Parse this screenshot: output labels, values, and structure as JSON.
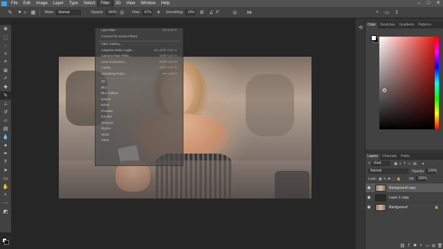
{
  "menu": [
    "File",
    "Edit",
    "Image",
    "Layer",
    "Type",
    "Select",
    "Filter",
    "3D",
    "View",
    "Window",
    "Help"
  ],
  "menu_active_index": 6,
  "window_controls": [
    "–",
    "□",
    "✕"
  ],
  "options": {
    "brush_size": "30",
    "mode_label": "Mode:",
    "mode_value": "Normal",
    "opacity_label": "Opacity:",
    "opacity_value": "100%",
    "flow_label": "Flow:",
    "flow_value": "67%",
    "smoothing_label": "Smoothing:",
    "smoothing_value": "10%",
    "angle_value": "0°"
  },
  "filter_menu": [
    {
      "label": "Last Filter",
      "shortcut": "Alt+Ctrl+F"
    },
    {
      "label": "Convert for Smart Filters",
      "shortcut": ""
    },
    {
      "sep": true
    },
    {
      "label": "Filter Gallery...",
      "shortcut": ""
    },
    {
      "label": "Adaptive Wide Angle...",
      "shortcut": "Alt+Shift+Ctrl+A"
    },
    {
      "label": "Camera Raw Filter...",
      "shortcut": "Shift+Ctrl+A"
    },
    {
      "label": "Lens Correction...",
      "shortcut": "Shift+Ctrl+R"
    },
    {
      "label": "Liquify...",
      "shortcut": "Shift+Ctrl+X"
    },
    {
      "label": "Vanishing Point...",
      "shortcut": "Alt+Ctrl+V"
    },
    {
      "sep": true
    },
    {
      "label": "3D",
      "shortcut": ""
    },
    {
      "label": "Blur",
      "shortcut": ""
    },
    {
      "label": "Blur Gallery",
      "shortcut": ""
    },
    {
      "label": "Distort",
      "shortcut": ""
    },
    {
      "label": "Noise",
      "shortcut": ""
    },
    {
      "label": "Pixelate",
      "shortcut": ""
    },
    {
      "label": "Render",
      "shortcut": ""
    },
    {
      "label": "Sharpen",
      "shortcut": ""
    },
    {
      "label": "Stylize",
      "shortcut": ""
    },
    {
      "label": "Video",
      "shortcut": ""
    },
    {
      "label": "Other",
      "shortcut": ""
    }
  ],
  "color_panel": {
    "tabs": [
      "Color",
      "Swatches",
      "Gradients",
      "Patterns"
    ],
    "active_tab": 0,
    "hue_color": "#e81b14"
  },
  "layers_panel": {
    "tabs": [
      "Layers",
      "Channels",
      "Paths"
    ],
    "active_tab": 0,
    "kind_label": "Kind",
    "blend_mode": "Normal",
    "opacity_label": "Opacity:",
    "opacity_value": "100%",
    "lock_label": "Lock:",
    "fill_label": "Fill:",
    "fill_value": "100%",
    "layers": [
      {
        "name": "Background copy",
        "selected": true,
        "italic": false
      },
      {
        "name": "Layer 1 copy",
        "selected": false,
        "italic": false
      },
      {
        "name": "Background",
        "selected": false,
        "italic": true
      }
    ]
  }
}
